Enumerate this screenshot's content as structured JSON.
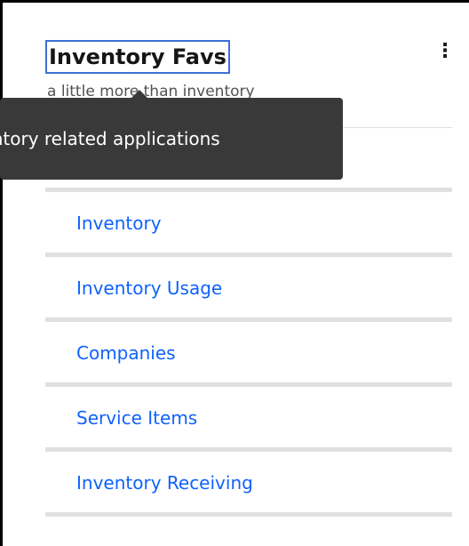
{
  "card": {
    "title": "Inventory Favs",
    "subtitle": "a little more than inventory",
    "menu_icon": "overflow-menu-vertical-icon"
  },
  "tooltip": {
    "text": "Inventory related applications"
  },
  "links": [
    {
      "label": "Inventory"
    },
    {
      "label": "Inventory Usage"
    },
    {
      "label": "Companies"
    },
    {
      "label": "Service Items"
    },
    {
      "label": "Inventory Receiving"
    }
  ],
  "colors": {
    "link": "#0f62fe",
    "focus_outline": "#3d70d6",
    "tooltip_background": "#393939",
    "divider": "#e0e0e0"
  }
}
